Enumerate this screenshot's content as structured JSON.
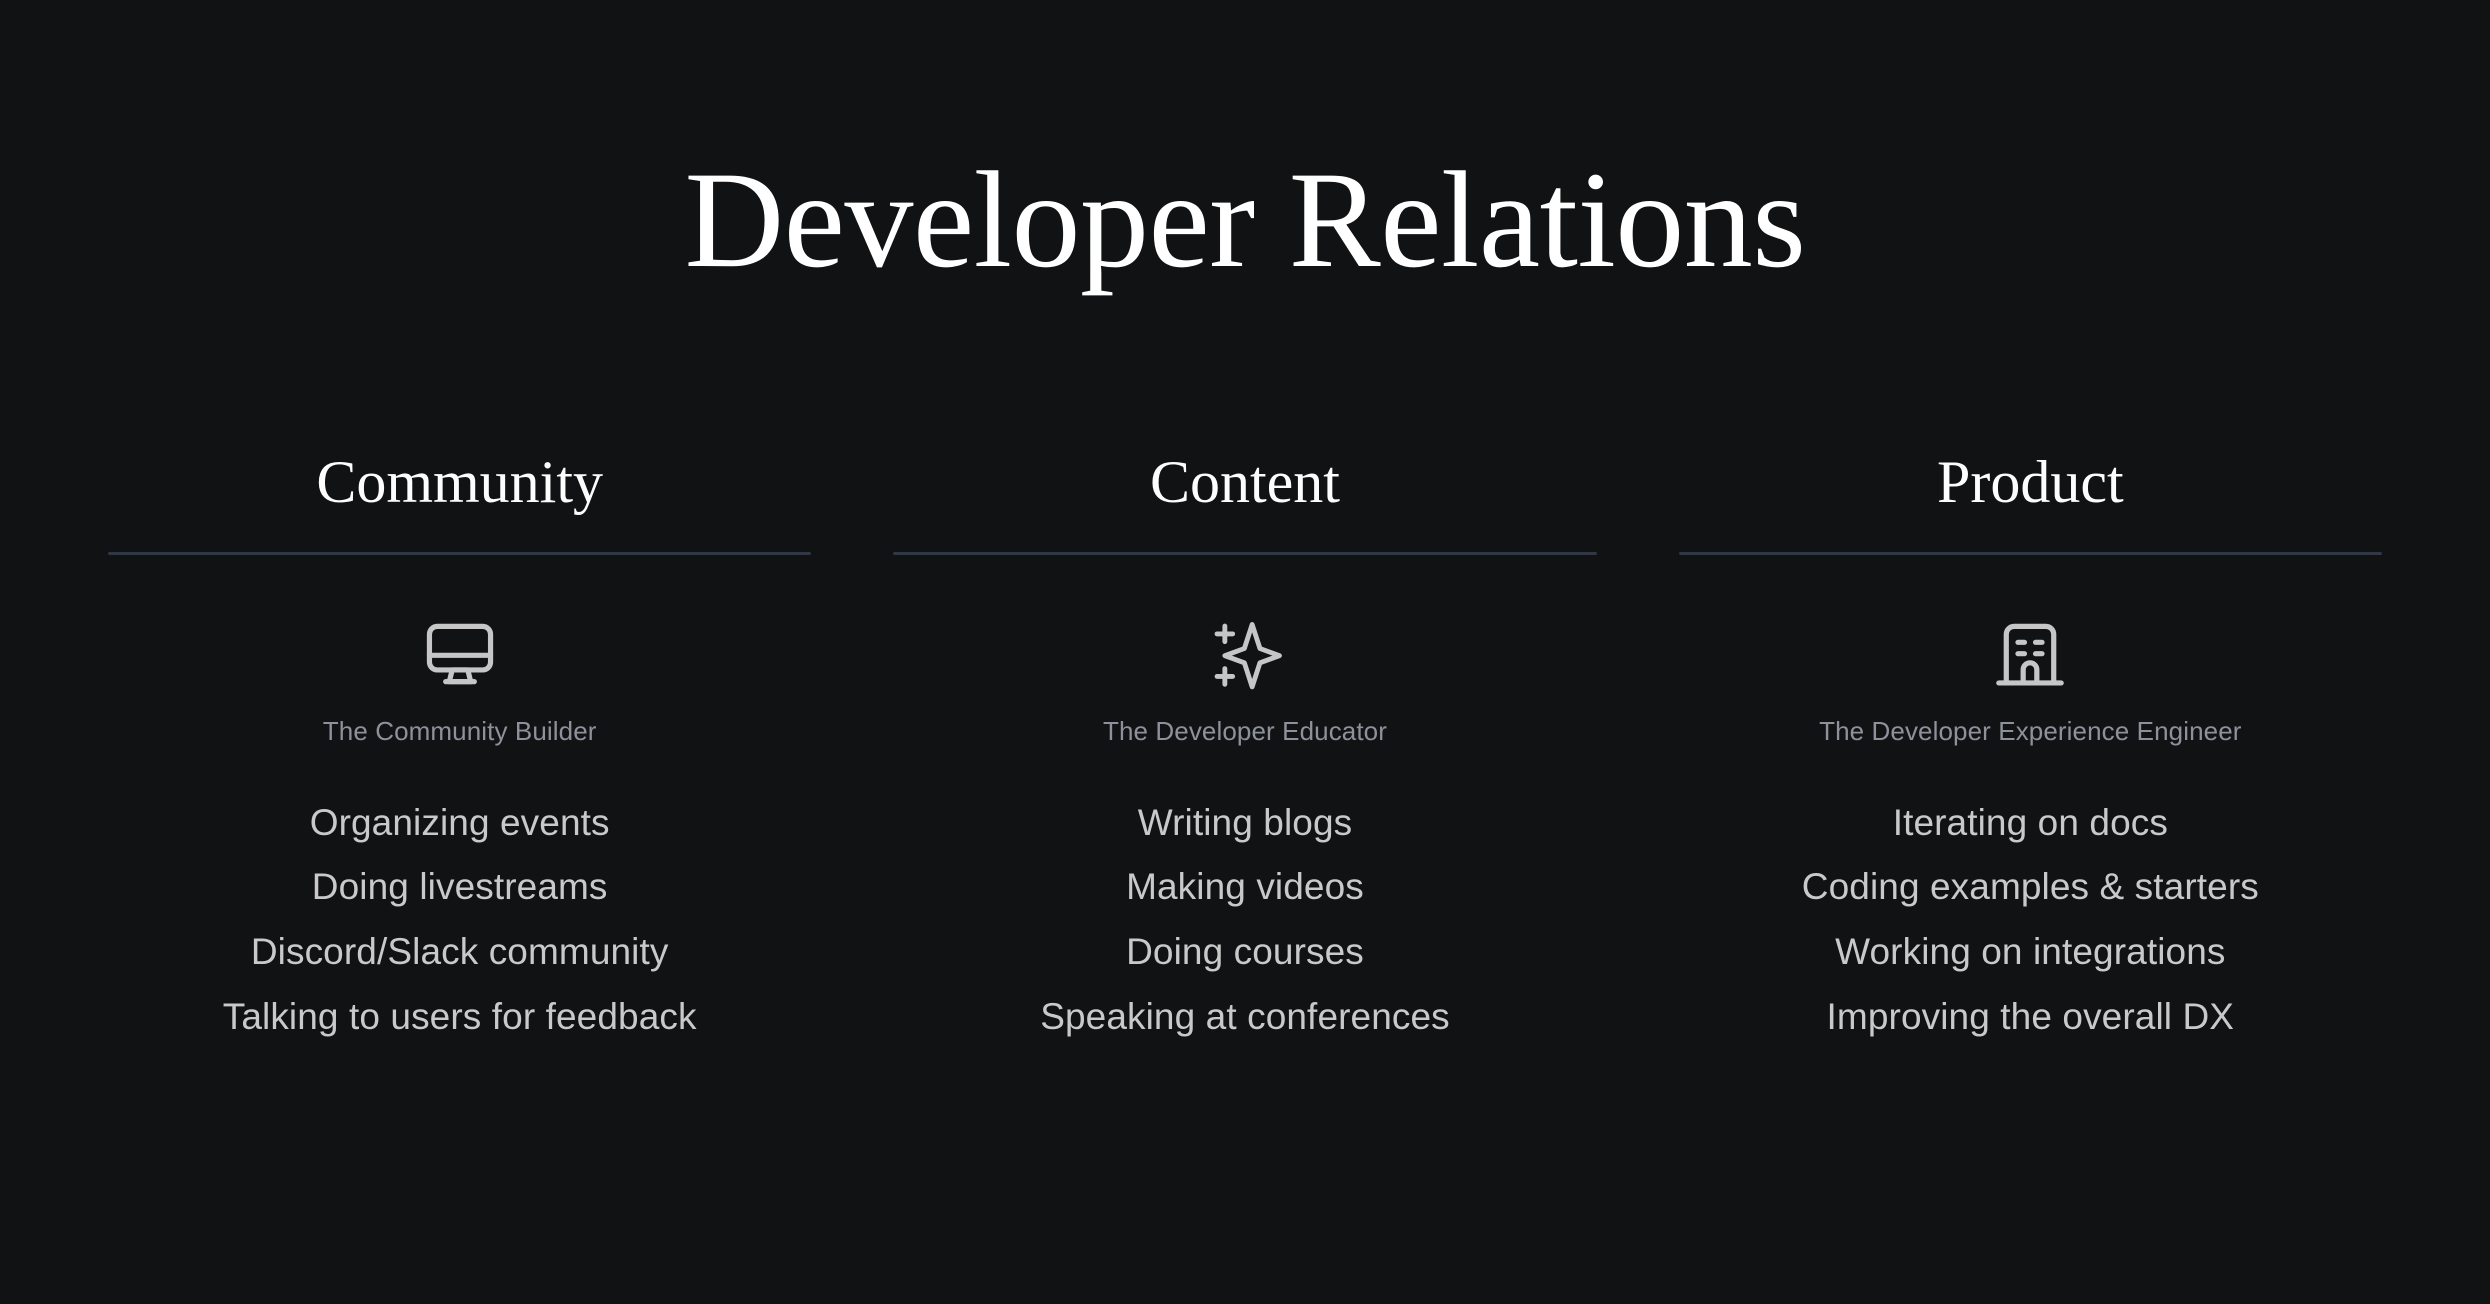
{
  "slide": {
    "title": "Developer Relations",
    "background_color": "#111214",
    "title_color": "#ffffff",
    "rule_color": "#2e3848",
    "persona_color": "#8d919b",
    "item_color": "#c9c9c9",
    "icon_color": "#c6c6c6"
  },
  "columns": [
    {
      "heading": "Community",
      "icon": "monitor-icon",
      "persona": "The Community Builder",
      "items": [
        "Organizing events",
        "Doing livestreams",
        "Discord/Slack community",
        "Talking to users for feedback"
      ]
    },
    {
      "heading": "Content",
      "icon": "sparkle-icon",
      "persona": "The Developer Educator",
      "items": [
        "Writing blogs",
        "Making videos",
        "Doing courses",
        "Speaking at conferences"
      ]
    },
    {
      "heading": "Product",
      "icon": "building-icon",
      "persona": "The Developer Experience Engineer",
      "items": [
        "Iterating on docs",
        "Coding examples & starters",
        "Working on integrations",
        "Improving the overall DX"
      ]
    }
  ]
}
